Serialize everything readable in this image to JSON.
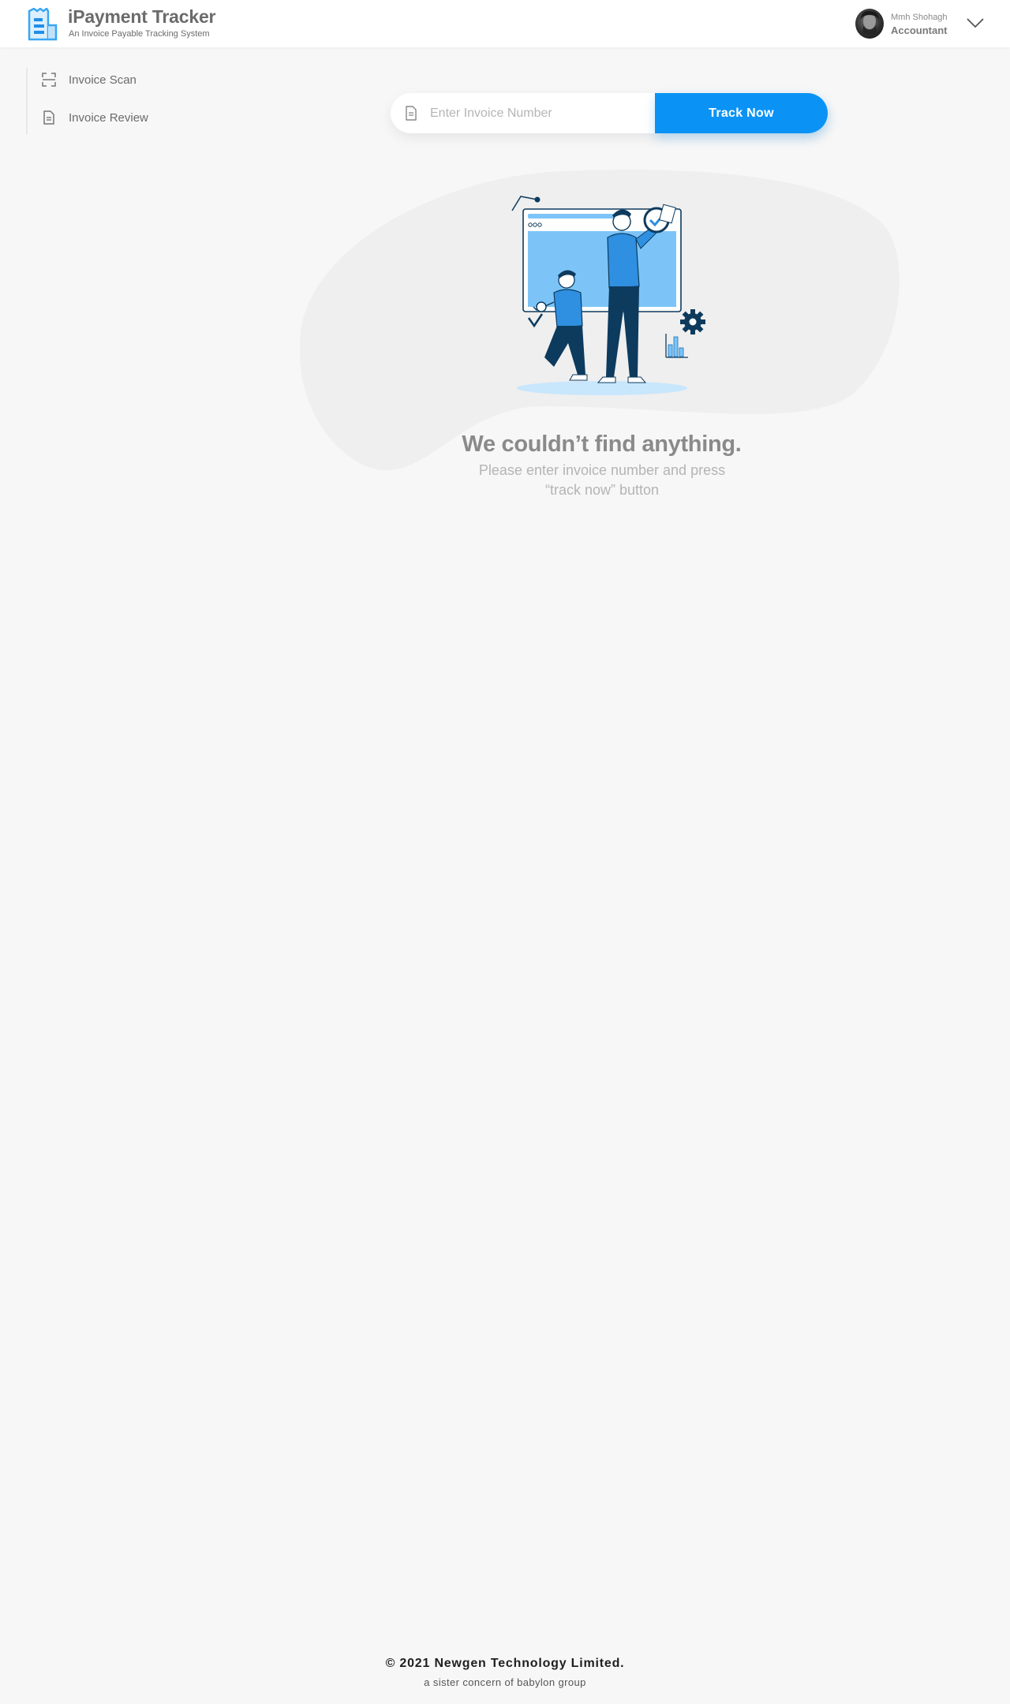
{
  "header": {
    "app_title": "iPayment Tracker",
    "app_subtitle": "An Invoice Payable Tracking System",
    "user": {
      "name": "Mmh Shohagh",
      "role": "Accountant"
    }
  },
  "sidebar": {
    "items": [
      {
        "label": "Invoice Scan",
        "icon": "scan-icon"
      },
      {
        "label": "Invoice Review",
        "icon": "document-icon"
      }
    ]
  },
  "search": {
    "placeholder": "Enter Invoice Number",
    "value": "",
    "button_label": "Track Now"
  },
  "empty_state": {
    "title": "We couldn’t find anything.",
    "message_line1": "Please enter invoice number and press",
    "message_line2": "“track now” button"
  },
  "footer": {
    "copyright": "© 2021 Newgen Technology Limited.",
    "tagline": "a sister concern of babylon group"
  },
  "colors": {
    "accent": "#0a93f5",
    "background": "#f7f7f7",
    "illustration_dark": "#0d3b5e",
    "illustration_light": "#7cc4f8"
  }
}
